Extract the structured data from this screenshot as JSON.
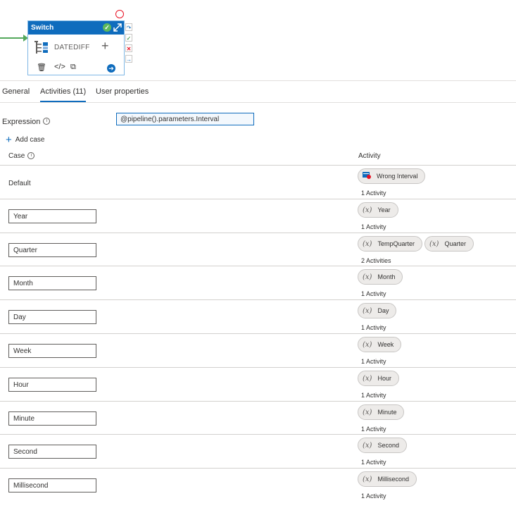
{
  "node": {
    "title": "Switch",
    "label": "DATEDIFF",
    "plus": "+"
  },
  "tabs": [
    {
      "label": "General",
      "active": false
    },
    {
      "label": "Activities (11)",
      "active": true
    },
    {
      "label": "User properties",
      "active": false
    }
  ],
  "expression": {
    "label": "Expression",
    "value": "@pipeline().parameters.Interval"
  },
  "add_case_label": "Add case",
  "columns": {
    "case": "Case",
    "activity": "Activity"
  },
  "rows": [
    {
      "case": "Default",
      "editable": false,
      "activities": [
        {
          "name": "Wrong Interval",
          "icon": "fail-activity-icon"
        }
      ],
      "count": "1 Activity"
    },
    {
      "case": "Year",
      "editable": true,
      "activities": [
        {
          "name": "Year",
          "icon": "variable-icon"
        }
      ],
      "count": "1 Activity"
    },
    {
      "case": "Quarter",
      "editable": true,
      "activities": [
        {
          "name": "TempQuarter",
          "icon": "variable-icon"
        },
        {
          "name": "Quarter",
          "icon": "variable-icon"
        }
      ],
      "count": "2 Activities"
    },
    {
      "case": "Month",
      "editable": true,
      "activities": [
        {
          "name": "Month",
          "icon": "variable-icon"
        }
      ],
      "count": "1 Activity"
    },
    {
      "case": "Day",
      "editable": true,
      "activities": [
        {
          "name": "Day",
          "icon": "variable-icon"
        }
      ],
      "count": "1 Activity"
    },
    {
      "case": "Week",
      "editable": true,
      "activities": [
        {
          "name": "Week",
          "icon": "variable-icon"
        }
      ],
      "count": "1 Activity"
    },
    {
      "case": "Hour",
      "editable": true,
      "activities": [
        {
          "name": "Hour",
          "icon": "variable-icon"
        }
      ],
      "count": "1 Activity"
    },
    {
      "case": "Minute",
      "editable": true,
      "activities": [
        {
          "name": "Minute",
          "icon": "variable-icon"
        }
      ],
      "count": "1 Activity"
    },
    {
      "case": "Second",
      "editable": true,
      "activities": [
        {
          "name": "Second",
          "icon": "variable-icon"
        }
      ],
      "count": "1 Activity"
    },
    {
      "case": "Millisecond",
      "editable": true,
      "activities": [
        {
          "name": "Millisecond",
          "icon": "variable-icon"
        }
      ],
      "count": "1 Activity"
    }
  ],
  "variable_icon_glyph": "(x)",
  "colors": {
    "accent": "#0f6cbd",
    "success": "#5cb85c",
    "error": "#e81123",
    "connector": "#54a85c"
  }
}
